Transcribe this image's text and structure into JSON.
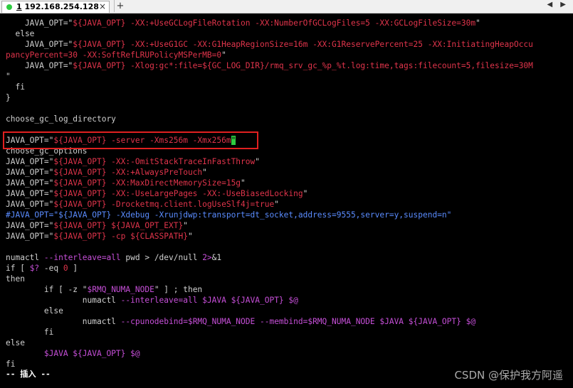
{
  "tab": {
    "number": "1",
    "host": "192.168.254.128",
    "close": "×",
    "add": "+",
    "nav": "◀ ▶"
  },
  "lines": [
    {
      "segs": [
        {
          "t": "    JAVA_OPT=\"",
          "c": "w"
        },
        {
          "t": "${JAVA_OPT} -XX:+UseGCLogFileRotation -XX:NumberOfGCLogFiles=5 -XX:GCLogFileSize=30m",
          "c": "r"
        },
        {
          "t": "\"",
          "c": "w"
        }
      ]
    },
    {
      "segs": [
        {
          "t": "  else",
          "c": "y"
        }
      ]
    },
    {
      "segs": [
        {
          "t": "    JAVA_OPT=\"",
          "c": "w"
        },
        {
          "t": "${JAVA_OPT} -XX:+UseG1GC -XX:G1HeapRegionSize=16m -XX:G1ReservePercent=25 -XX:InitiatingHeapOccu",
          "c": "r"
        }
      ]
    },
    {
      "segs": [
        {
          "t": "pancyPercent=30 -XX:SoftRefLRUPolicyMSPerMB=0",
          "c": "r"
        },
        {
          "t": "\"",
          "c": "w"
        }
      ]
    },
    {
      "segs": [
        {
          "t": "    JAVA_OPT=\"",
          "c": "w"
        },
        {
          "t": "${JAVA_OPT} -Xlog:gc*:file=${GC_LOG_DIR}/rmq_srv_gc_%p_%t.log:time,tags:filecount=5,filesize=30M",
          "c": "r"
        }
      ]
    },
    {
      "segs": [
        {
          "t": "\"",
          "c": "w"
        }
      ]
    },
    {
      "segs": [
        {
          "t": "  fi",
          "c": "y"
        }
      ]
    },
    {
      "segs": [
        {
          "t": "}",
          "c": "w"
        }
      ]
    },
    {
      "segs": [
        {
          "t": "",
          "c": "w"
        }
      ]
    },
    {
      "segs": [
        {
          "t": "choose_gc_log_directory",
          "c": "w"
        }
      ]
    },
    {
      "segs": [
        {
          "t": "",
          "c": "w"
        }
      ]
    },
    {
      "segs": [
        {
          "t": "JAVA_OPT=\"",
          "c": "w"
        },
        {
          "t": "${JAVA_OPT} -server -Xms256m -Xmx256m",
          "c": "r"
        },
        {
          "t": "\"",
          "c": "cursor"
        }
      ]
    },
    {
      "segs": [
        {
          "t": "choose_gc_options",
          "c": "w"
        }
      ]
    },
    {
      "segs": [
        {
          "t": "JAVA_OPT=\"",
          "c": "w"
        },
        {
          "t": "${JAVA_OPT} -XX:-OmitStackTraceInFastThrow",
          "c": "r"
        },
        {
          "t": "\"",
          "c": "w"
        }
      ]
    },
    {
      "segs": [
        {
          "t": "JAVA_OPT=\"",
          "c": "w"
        },
        {
          "t": "${JAVA_OPT} -XX:+AlwaysPreTouch",
          "c": "r"
        },
        {
          "t": "\"",
          "c": "w"
        }
      ]
    },
    {
      "segs": [
        {
          "t": "JAVA_OPT=\"",
          "c": "w"
        },
        {
          "t": "${JAVA_OPT} -XX:MaxDirectMemorySize=15g",
          "c": "r"
        },
        {
          "t": "\"",
          "c": "w"
        }
      ]
    },
    {
      "segs": [
        {
          "t": "JAVA_OPT=\"",
          "c": "w"
        },
        {
          "t": "${JAVA_OPT} -XX:-UseLargePages -XX:-UseBiasedLocking",
          "c": "r"
        },
        {
          "t": "\"",
          "c": "w"
        }
      ]
    },
    {
      "segs": [
        {
          "t": "JAVA_OPT=\"",
          "c": "w"
        },
        {
          "t": "${JAVA_OPT} -Drocketmq.client.logUseSlf4j=true",
          "c": "r"
        },
        {
          "t": "\"",
          "c": "w"
        }
      ]
    },
    {
      "segs": [
        {
          "t": "#JAVA_OPT=\"${JAVA_OPT} -Xdebug -Xrunjdwp:transport=dt_socket,address=9555,server=y,suspend=n\"",
          "c": "b"
        }
      ]
    },
    {
      "segs": [
        {
          "t": "JAVA_OPT=\"",
          "c": "w"
        },
        {
          "t": "${JAVA_OPT} ${JAVA_OPT_EXT}",
          "c": "r"
        },
        {
          "t": "\"",
          "c": "w"
        }
      ]
    },
    {
      "segs": [
        {
          "t": "JAVA_OPT=\"",
          "c": "w"
        },
        {
          "t": "${JAVA_OPT} -cp ${CLASSPATH}",
          "c": "r"
        },
        {
          "t": "\"",
          "c": "w"
        }
      ]
    },
    {
      "segs": [
        {
          "t": "",
          "c": "w"
        }
      ]
    },
    {
      "segs": [
        {
          "t": "numactl ",
          "c": "w"
        },
        {
          "t": "--interleave=all",
          "c": "m"
        },
        {
          "t": " pwd > /dev/null ",
          "c": "w"
        },
        {
          "t": "2>",
          "c": "m"
        },
        {
          "t": "&1",
          "c": "w"
        }
      ]
    },
    {
      "segs": [
        {
          "t": "if [ ",
          "c": "y"
        },
        {
          "t": "$?",
          "c": "m"
        },
        {
          "t": " -eq ",
          "c": "y"
        },
        {
          "t": "0",
          "c": "r"
        },
        {
          "t": " ]",
          "c": "y"
        }
      ]
    },
    {
      "segs": [
        {
          "t": "then",
          "c": "y"
        }
      ]
    },
    {
      "segs": [
        {
          "t": "        if [ -z \"",
          "c": "y"
        },
        {
          "t": "$RMQ_NUMA_NODE",
          "c": "m"
        },
        {
          "t": "\" ] ; then",
          "c": "y"
        }
      ]
    },
    {
      "segs": [
        {
          "t": "                numactl ",
          "c": "w"
        },
        {
          "t": "--interleave=all $JAVA ${JAVA_OPT} $@",
          "c": "m"
        }
      ]
    },
    {
      "segs": [
        {
          "t": "        else",
          "c": "y"
        }
      ]
    },
    {
      "segs": [
        {
          "t": "                numactl ",
          "c": "w"
        },
        {
          "t": "--cpunodebind=$RMQ_NUMA_NODE --membind=$RMQ_NUMA_NODE $JAVA ${JAVA_OPT} $@",
          "c": "m"
        }
      ]
    },
    {
      "segs": [
        {
          "t": "        fi",
          "c": "y"
        }
      ]
    },
    {
      "segs": [
        {
          "t": "else",
          "c": "y"
        }
      ]
    },
    {
      "segs": [
        {
          "t": "        $JAVA ${JAVA_OPT} $@",
          "c": "m"
        }
      ]
    },
    {
      "segs": [
        {
          "t": "fi",
          "c": "y"
        }
      ]
    }
  ],
  "status": "-- 插入 --",
  "watermark": "CSDN @保护我方阿遥",
  "colors": {
    "background": "#000000",
    "string": "#e0344b",
    "variable": "#c64fd8",
    "comment": "#5a8cff",
    "cursor": "#2ecc40",
    "highlight_box": "#e02020"
  }
}
